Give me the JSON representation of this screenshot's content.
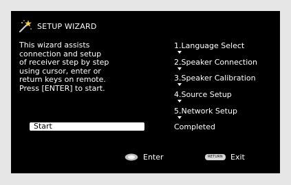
{
  "wizard": {
    "title": "SETUP WIZARD",
    "description_lines": [
      "This wizard assists",
      "connection and setup",
      "of receiver step by step",
      "using cursor, enter or",
      "return keys on remote.",
      "Press [ENTER] to start."
    ],
    "start_label": "Start",
    "steps": [
      "1.Language Select",
      "2.Speaker Connection",
      "3.Speaker Calibration",
      "4.Source Setup",
      "5.Network Setup",
      "Completed"
    ]
  },
  "footer": {
    "enter_label": "Enter",
    "return_key_label": "RETURN",
    "exit_label": "Exit"
  },
  "icons": {
    "title": "magic-wand-icon",
    "enter": "enter-button-icon",
    "return": "return-key-icon",
    "arrow": "down-arrow-icon"
  }
}
